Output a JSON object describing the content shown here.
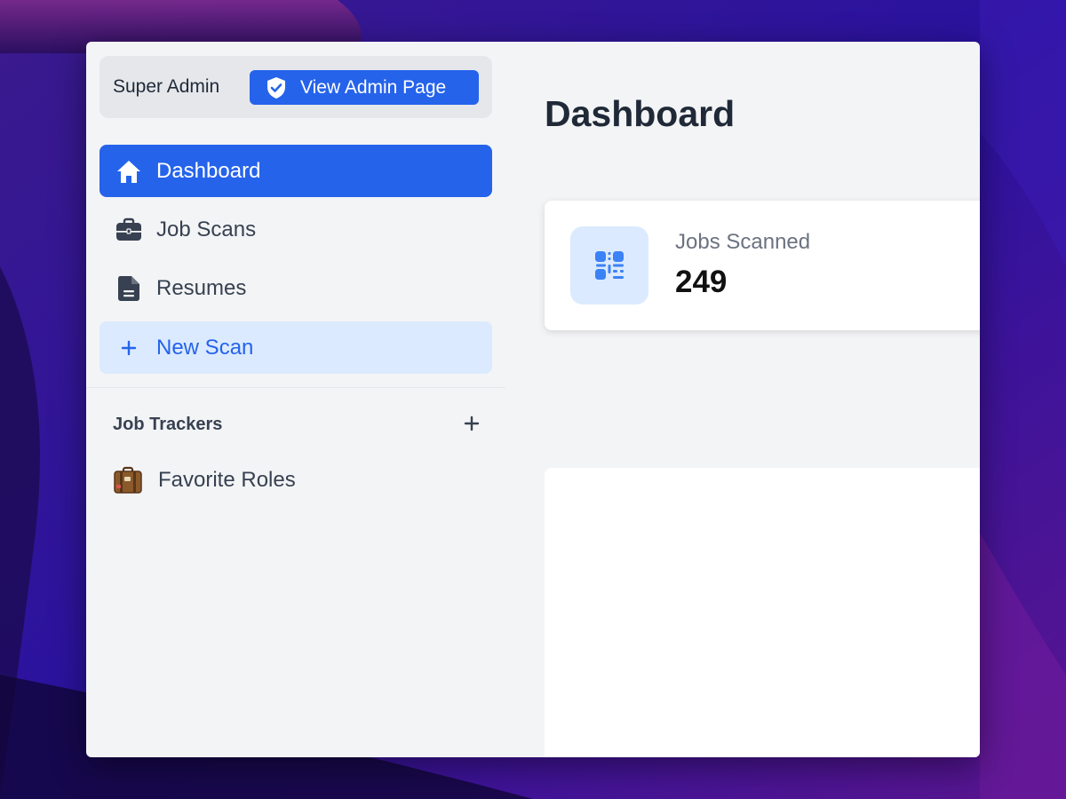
{
  "admin": {
    "role_label": "Super Admin",
    "button_label": "View Admin Page",
    "button_icon": "shield-check-icon"
  },
  "nav": {
    "items": [
      {
        "label": "Dashboard",
        "icon": "home-icon",
        "active": true
      },
      {
        "label": "Job Scans",
        "icon": "briefcase-icon",
        "active": false
      },
      {
        "label": "Resumes",
        "icon": "document-icon",
        "active": false
      },
      {
        "label": "New Scan",
        "icon": "plus-icon",
        "active": false
      }
    ]
  },
  "trackers": {
    "title": "Job Trackers",
    "add_icon": "plus-icon",
    "items": [
      {
        "label": "Favorite Roles",
        "icon": "suitcase-emoji-icon"
      }
    ]
  },
  "main": {
    "title": "Dashboard",
    "stats": [
      {
        "label": "Jobs Scanned",
        "value": "249",
        "icon": "qr-code-icon"
      }
    ]
  },
  "colors": {
    "accent": "#2563eb",
    "accent_light": "#dbeafe",
    "sidebar_bg": "#f3f4f6",
    "text_dark": "#1f2937",
    "text_muted": "#6b7280"
  }
}
